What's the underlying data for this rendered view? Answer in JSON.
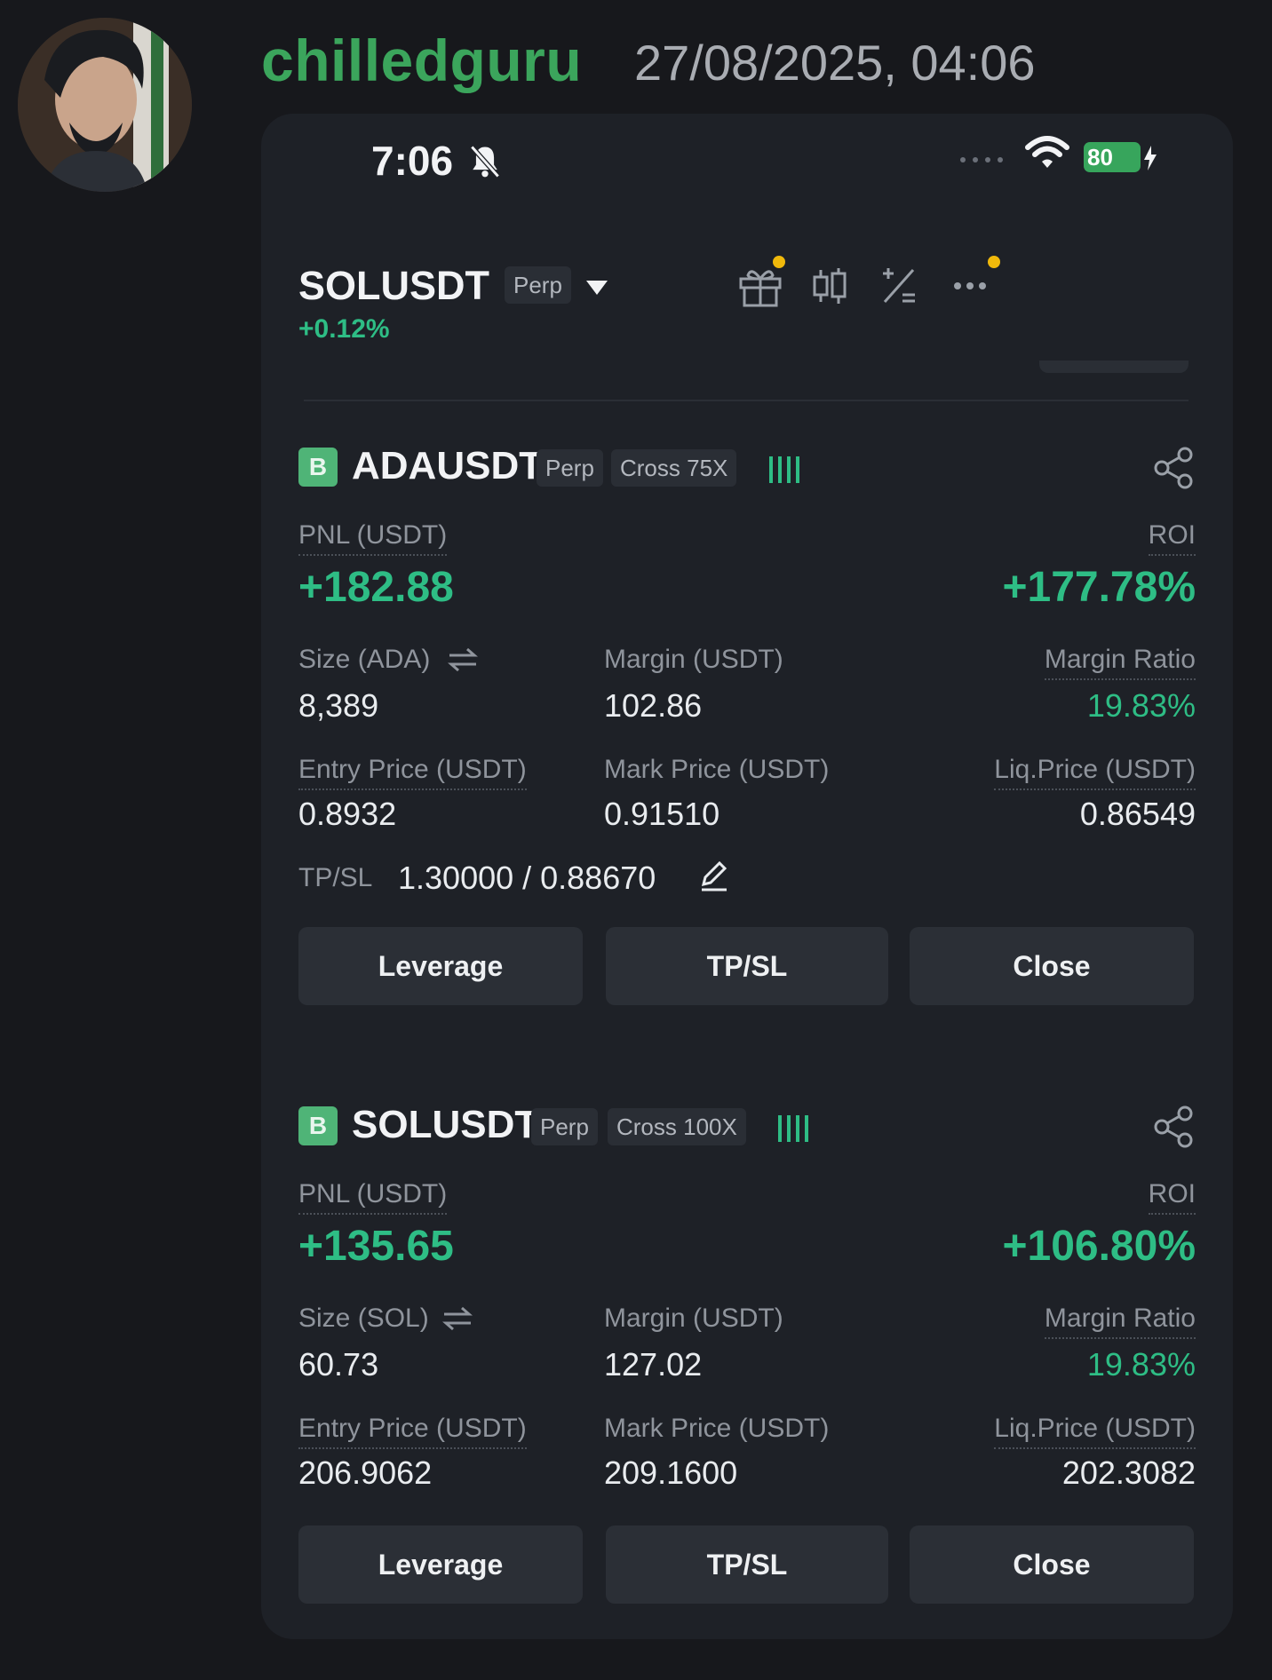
{
  "message": {
    "username": "chilledguru",
    "timestamp": "27/08/2025, 04:06"
  },
  "status_bar": {
    "time": "7:06",
    "battery": "80"
  },
  "header": {
    "symbol": "SOLUSDT",
    "type": "Perp",
    "change": "+0.12%"
  },
  "positions": [
    {
      "side": "B",
      "symbol": "ADAUSDT",
      "type": "Perp",
      "margin_mode": "Cross 75X",
      "pnl_label": "PNL (USDT)",
      "pnl": "+182.88",
      "roi_label": "ROI",
      "roi": "+177.78%",
      "size_label": "Size (ADA)",
      "size": "8,389",
      "margin_label": "Margin (USDT)",
      "margin": "102.86",
      "margin_ratio_label": "Margin Ratio",
      "margin_ratio": "19.83%",
      "entry_label": "Entry Price (USDT)",
      "entry": "0.8932",
      "mark_label": "Mark Price (USDT)",
      "mark": "0.91510",
      "liq_label": "Liq.Price (USDT)",
      "liq": "0.86549",
      "tpsl_label": "TP/SL",
      "tpsl": "1.30000 / 0.88670",
      "buttons": [
        "Leverage",
        "TP/SL",
        "Close"
      ]
    },
    {
      "side": "B",
      "symbol": "SOLUSDT",
      "type": "Perp",
      "margin_mode": "Cross 100X",
      "pnl_label": "PNL (USDT)",
      "pnl": "+135.65",
      "roi_label": "ROI",
      "roi": "+106.80%",
      "size_label": "Size (SOL)",
      "size": "60.73",
      "margin_label": "Margin (USDT)",
      "margin": "127.02",
      "margin_ratio_label": "Margin Ratio",
      "margin_ratio": "19.83%",
      "entry_label": "Entry Price (USDT)",
      "entry": "206.9062",
      "mark_label": "Mark Price (USDT)",
      "mark": "209.1600",
      "liq_label": "Liq.Price (USDT)",
      "liq": "202.3082",
      "buttons": [
        "Leverage",
        "TP/SL",
        "Close"
      ]
    }
  ],
  "colors": {
    "username": "#3ba55c",
    "positive": "#2ebd85",
    "buy_badge": "#4fb477",
    "notification_dot": "#f0b90b"
  },
  "icons": [
    "bell-muted-icon",
    "wifi-icon",
    "gift-icon",
    "candlestick-icon",
    "calculator-icon",
    "more-icon",
    "share-icon",
    "swap-icon",
    "edit-icon",
    "signal-bars-icon"
  ]
}
